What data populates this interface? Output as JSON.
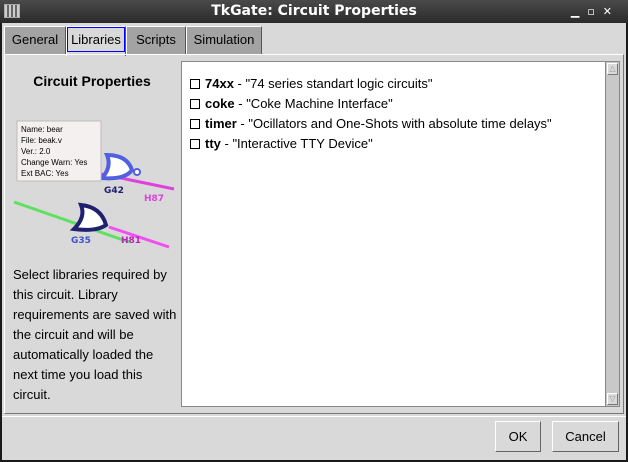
{
  "window": {
    "title": "TkGate: Circuit Properties"
  },
  "tabs": [
    {
      "label": "General"
    },
    {
      "label": "Libraries"
    },
    {
      "label": "Scripts"
    },
    {
      "label": "Simulation"
    }
  ],
  "left": {
    "title": "Circuit Properties",
    "description": "Select libraries required by this circuit. Library requirements are saved with the circuit and will be automatically loaded the next time you load this circuit.",
    "illustration_labels": [
      "Name: bear",
      "File: beak.v",
      "Ver.: 2.0",
      "Change Warn: Yes",
      "Ext BAC: Yes",
      "G42",
      "H87",
      "G35",
      "H81"
    ]
  },
  "libraries": [
    {
      "name": "74xx",
      "desc": " - \"74 series standart logic circuits\"",
      "checked": false
    },
    {
      "name": "coke",
      "desc": " - \"Coke Machine Interface\"",
      "checked": false
    },
    {
      "name": "timer",
      "desc": " - \"Ocillators and One-Shots with absolute time delays\"",
      "checked": false
    },
    {
      "name": "tty",
      "desc": " - \"Interactive TTY Device\"",
      "checked": false
    }
  ],
  "buttons": {
    "ok": "OK",
    "cancel": "Cancel"
  }
}
